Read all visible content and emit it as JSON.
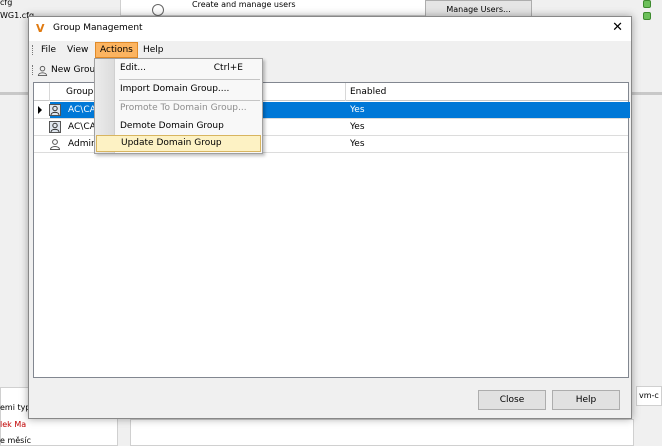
{
  "background_app": {
    "left_texts": [
      "cfg",
      "WG1.cfg"
    ],
    "option_label": "Create and manage users",
    "manage_button": "Manage Users...",
    "bottom_texts": [
      "emi typ",
      "lek Ma",
      "e měsíc"
    ],
    "right_text": "vm-c"
  },
  "dialog": {
    "title": "Group Management",
    "title_icon": "V",
    "close_glyph": "✕"
  },
  "menubar": {
    "items": [
      "File",
      "View",
      "Actions",
      "Help"
    ],
    "active": "Actions"
  },
  "toolbar": {
    "new_group_label": "New Grou"
  },
  "grid": {
    "columns": [
      "Group",
      "Enabled"
    ],
    "rows": [
      {
        "group": "AC\\CA",
        "enabled": "Yes",
        "selected": true,
        "icon": "domain-group-icon"
      },
      {
        "group": "AC\\CA",
        "enabled": "Yes",
        "selected": false,
        "icon": "domain-group-icon"
      },
      {
        "group": "Admin",
        "enabled": "Yes",
        "selected": false,
        "icon": "user-group-icon"
      }
    ]
  },
  "actions_menu": {
    "edit": "Edit...",
    "edit_shortcut": "Ctrl+E",
    "import": "Import Domain Group....",
    "promote": "Promote To Domain Group...",
    "demote": "Demote Domain Group",
    "update": "Update Domain Group"
  },
  "buttons": {
    "close": "Close",
    "help": "Help"
  },
  "colors": {
    "accent_selection": "#0078d7",
    "active_menu": "#fcb460",
    "status_green": "#6cc05a"
  }
}
